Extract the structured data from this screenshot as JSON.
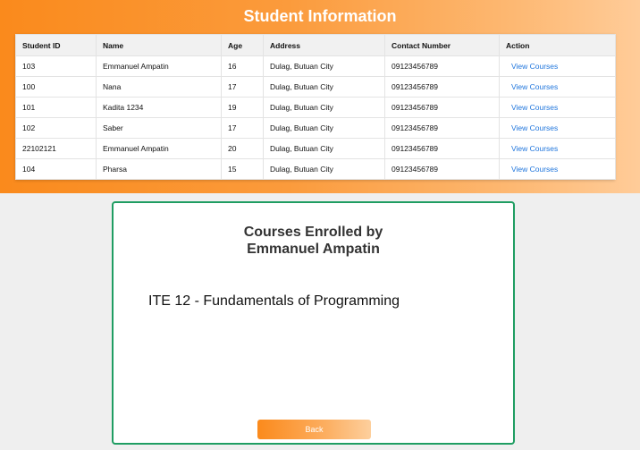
{
  "header": {
    "title": "Student Information"
  },
  "table": {
    "columns": [
      "Student ID",
      "Name",
      "Age",
      "Address",
      "Contact Number",
      "Action"
    ],
    "rows": [
      {
        "id": "103",
        "name": "Emmanuel Ampatin",
        "age": "16",
        "address": "Dulag, Butuan City",
        "contact": "09123456789",
        "action": "View Courses"
      },
      {
        "id": "100",
        "name": "Nana",
        "age": "17",
        "address": "Dulag, Butuan City",
        "contact": "09123456789",
        "action": "View Courses"
      },
      {
        "id": "101",
        "name": "Kadita 1234",
        "age": "19",
        "address": "Dulag, Butuan City",
        "contact": "09123456789",
        "action": "View Courses"
      },
      {
        "id": "102",
        "name": "Saber",
        "age": "17",
        "address": "Dulag, Butuan City",
        "contact": "09123456789",
        "action": "View Courses"
      },
      {
        "id": "22102121",
        "name": "Emmanuel Ampatin",
        "age": "20",
        "address": "Dulag, Butuan City",
        "contact": "09123456789",
        "action": "View Courses"
      },
      {
        "id": "104",
        "name": "Pharsa",
        "age": "15",
        "address": "Dulag, Butuan City",
        "contact": "09123456789",
        "action": "View Courses"
      }
    ]
  },
  "modal": {
    "title_line1": "Courses Enrolled by",
    "title_line2": "Emmanuel Ampatin",
    "courses": [
      "ITE 12 - Fundamentals of Programming"
    ],
    "back_label": "Back"
  },
  "colors": {
    "header_gradient_start": "#fa8a1c",
    "header_gradient_end": "#ffcc99",
    "modal_border": "#1f9d62",
    "link": "#2277dd"
  }
}
